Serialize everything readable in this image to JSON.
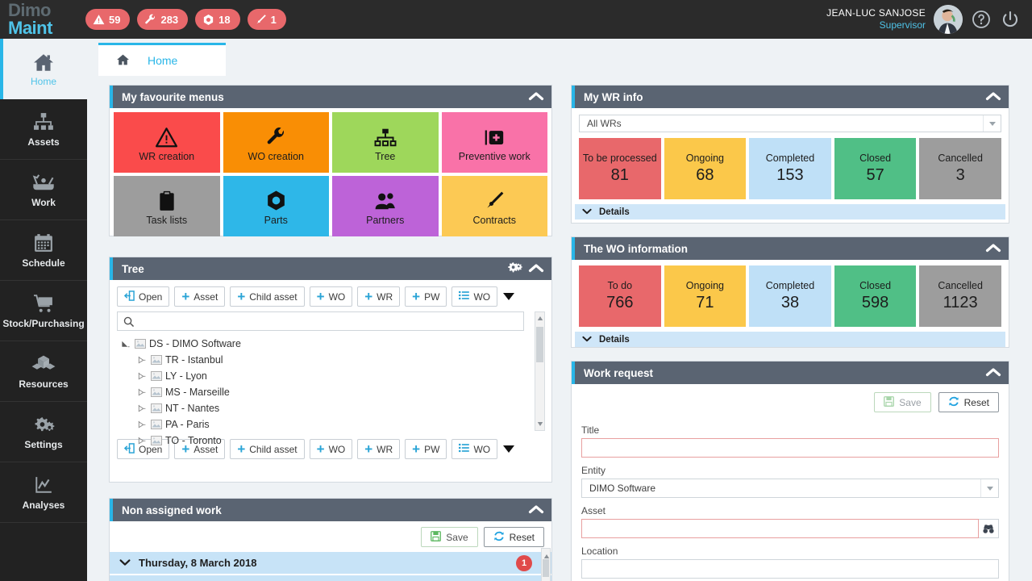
{
  "brand": {
    "line1": "Dimo",
    "line2": "Maint"
  },
  "header": {
    "badges": [
      {
        "icon": "warning-triangle-icon",
        "count": "59"
      },
      {
        "icon": "wrench-icon",
        "count": "283"
      },
      {
        "icon": "nut-icon",
        "count": "18"
      },
      {
        "icon": "pen-nib-icon",
        "count": "1"
      }
    ],
    "user_name": "JEAN-LUC SANJOSE",
    "user_role": "Supervisor",
    "help_icon": "help-circle-icon",
    "power_icon": "power-icon"
  },
  "sidebar": {
    "items": [
      {
        "label": "Home",
        "icon": "home-icon",
        "active": true
      },
      {
        "label": "Assets",
        "icon": "hierarchy-icon"
      },
      {
        "label": "Work",
        "icon": "tools-icon"
      },
      {
        "label": "Schedule",
        "icon": "calendar-icon"
      },
      {
        "label": "Stock/Purchasing",
        "icon": "cart-icon"
      },
      {
        "label": "Resources",
        "icon": "boxes-icon"
      },
      {
        "label": "Settings",
        "icon": "gears-icon"
      },
      {
        "label": "Analyses",
        "icon": "chart-icon"
      }
    ]
  },
  "tabs": [
    {
      "label": "Home",
      "icon": "home-icon",
      "active": true
    }
  ],
  "favourites": {
    "title": "My favourite menus",
    "tiles": [
      {
        "label": "WR creation",
        "icon": "warning-triangle-icon",
        "color": "#fa4b4b"
      },
      {
        "label": "WO creation",
        "icon": "wrench-icon",
        "color": "#f98e05"
      },
      {
        "label": "Tree",
        "icon": "hierarchy-icon",
        "color": "#9ed75b"
      },
      {
        "label": "Preventive work",
        "icon": "first-aid-icon",
        "color": "#f972a8"
      },
      {
        "label": "Task lists",
        "icon": "clipboard-icon",
        "color": "#9d9d9d"
      },
      {
        "label": "Parts",
        "icon": "nut-icon",
        "color": "#2eb7e8"
      },
      {
        "label": "Partners",
        "icon": "partners-icon",
        "color": "#bd63d8"
      },
      {
        "label": "Contracts",
        "icon": "pen-nib-icon",
        "color": "#fcc954"
      }
    ]
  },
  "tree": {
    "title": "Tree",
    "gear_icon": "gears-icon",
    "collapse_icon": "chevron-up-icon",
    "toolbar": [
      {
        "label": "Open",
        "icon": "open-icon"
      },
      {
        "label": "Asset",
        "icon": "plus-icon"
      },
      {
        "label": "Child asset",
        "icon": "plus-icon"
      },
      {
        "label": "WO",
        "icon": "plus-icon"
      },
      {
        "label": "WR",
        "icon": "plus-icon"
      },
      {
        "label": "PW",
        "icon": "plus-icon"
      },
      {
        "label": "WO",
        "icon": "list-icon"
      }
    ],
    "search_placeholder": "",
    "search_value": "",
    "nodes": [
      {
        "label": "DS - DIMO Software",
        "level": 0
      },
      {
        "label": "TR - Istanbul",
        "level": 1
      },
      {
        "label": "LY - Lyon",
        "level": 1
      },
      {
        "label": "MS - Marseille",
        "level": 1
      },
      {
        "label": "NT - Nantes",
        "level": 1
      },
      {
        "label": "PA - Paris",
        "level": 1
      },
      {
        "label": "TO - Toronto",
        "level": 1
      }
    ]
  },
  "non_assigned": {
    "title": "Non assigned work",
    "save_label": "Save",
    "reset_label": "Reset",
    "rows": [
      {
        "date": "Thursday, 8 March 2018",
        "count": "1"
      }
    ]
  },
  "wr_info": {
    "title": "My WR info",
    "filter_value": "All WRs",
    "details_label": "Details",
    "kpis": [
      {
        "label": "To be processed",
        "value": "81",
        "color": "#e8686b"
      },
      {
        "label": "Ongoing",
        "value": "68",
        "color": "#fbc84a"
      },
      {
        "label": "Completed",
        "value": "153",
        "color": "#bfe0f7"
      },
      {
        "label": "Closed",
        "value": "57",
        "color": "#50bf86"
      },
      {
        "label": "Cancelled",
        "value": "3",
        "color": "#9d9d9d"
      }
    ]
  },
  "wo_info": {
    "title": "The WO information",
    "details_label": "Details",
    "kpis": [
      {
        "label": "To do",
        "value": "766",
        "color": "#e8686b"
      },
      {
        "label": "Ongoing",
        "value": "71",
        "color": "#fbc84a"
      },
      {
        "label": "Completed",
        "value": "38",
        "color": "#bfe0f7"
      },
      {
        "label": "Closed",
        "value": "598",
        "color": "#50bf86"
      },
      {
        "label": "Cancelled",
        "value": "1123",
        "color": "#9d9d9d"
      }
    ]
  },
  "work_request": {
    "title": "Work request",
    "save_label": "Save",
    "reset_label": "Reset",
    "fields": {
      "title_label": "Title",
      "title_value": "",
      "entity_label": "Entity",
      "entity_value": "DIMO Software",
      "asset_label": "Asset",
      "asset_value": "",
      "asset_picker_icon": "binoculars-icon",
      "location_label": "Location",
      "location_value": ""
    }
  },
  "colors": {
    "accent": "#29b6e8",
    "panel_header": "#5a6472",
    "page_bg": "#eef2f5",
    "badge_red": "#e8686b"
  }
}
